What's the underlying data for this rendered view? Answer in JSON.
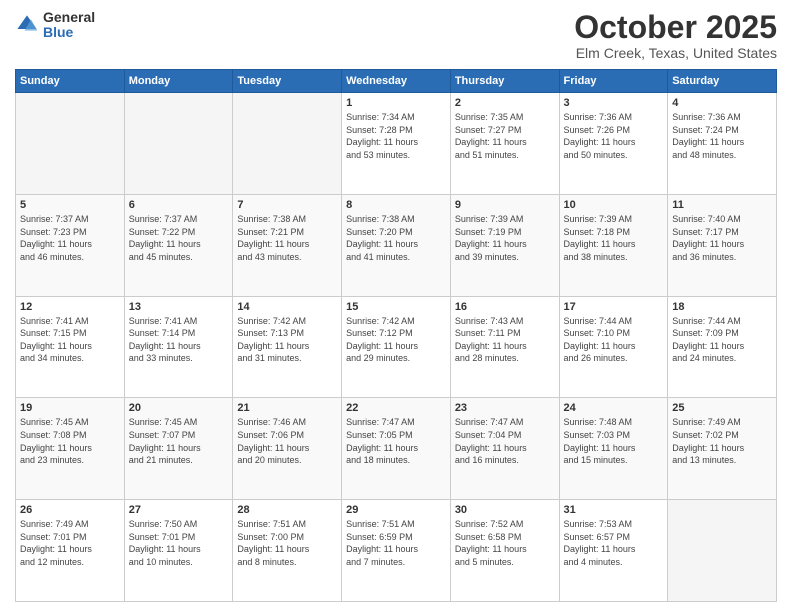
{
  "logo": {
    "general": "General",
    "blue": "Blue"
  },
  "header": {
    "month": "October 2025",
    "location": "Elm Creek, Texas, United States"
  },
  "weekdays": [
    "Sunday",
    "Monday",
    "Tuesday",
    "Wednesday",
    "Thursday",
    "Friday",
    "Saturday"
  ],
  "weeks": [
    [
      {
        "day": "",
        "info": ""
      },
      {
        "day": "",
        "info": ""
      },
      {
        "day": "",
        "info": ""
      },
      {
        "day": "1",
        "info": "Sunrise: 7:34 AM\nSunset: 7:28 PM\nDaylight: 11 hours\nand 53 minutes."
      },
      {
        "day": "2",
        "info": "Sunrise: 7:35 AM\nSunset: 7:27 PM\nDaylight: 11 hours\nand 51 minutes."
      },
      {
        "day": "3",
        "info": "Sunrise: 7:36 AM\nSunset: 7:26 PM\nDaylight: 11 hours\nand 50 minutes."
      },
      {
        "day": "4",
        "info": "Sunrise: 7:36 AM\nSunset: 7:24 PM\nDaylight: 11 hours\nand 48 minutes."
      }
    ],
    [
      {
        "day": "5",
        "info": "Sunrise: 7:37 AM\nSunset: 7:23 PM\nDaylight: 11 hours\nand 46 minutes."
      },
      {
        "day": "6",
        "info": "Sunrise: 7:37 AM\nSunset: 7:22 PM\nDaylight: 11 hours\nand 45 minutes."
      },
      {
        "day": "7",
        "info": "Sunrise: 7:38 AM\nSunset: 7:21 PM\nDaylight: 11 hours\nand 43 minutes."
      },
      {
        "day": "8",
        "info": "Sunrise: 7:38 AM\nSunset: 7:20 PM\nDaylight: 11 hours\nand 41 minutes."
      },
      {
        "day": "9",
        "info": "Sunrise: 7:39 AM\nSunset: 7:19 PM\nDaylight: 11 hours\nand 39 minutes."
      },
      {
        "day": "10",
        "info": "Sunrise: 7:39 AM\nSunset: 7:18 PM\nDaylight: 11 hours\nand 38 minutes."
      },
      {
        "day": "11",
        "info": "Sunrise: 7:40 AM\nSunset: 7:17 PM\nDaylight: 11 hours\nand 36 minutes."
      }
    ],
    [
      {
        "day": "12",
        "info": "Sunrise: 7:41 AM\nSunset: 7:15 PM\nDaylight: 11 hours\nand 34 minutes."
      },
      {
        "day": "13",
        "info": "Sunrise: 7:41 AM\nSunset: 7:14 PM\nDaylight: 11 hours\nand 33 minutes."
      },
      {
        "day": "14",
        "info": "Sunrise: 7:42 AM\nSunset: 7:13 PM\nDaylight: 11 hours\nand 31 minutes."
      },
      {
        "day": "15",
        "info": "Sunrise: 7:42 AM\nSunset: 7:12 PM\nDaylight: 11 hours\nand 29 minutes."
      },
      {
        "day": "16",
        "info": "Sunrise: 7:43 AM\nSunset: 7:11 PM\nDaylight: 11 hours\nand 28 minutes."
      },
      {
        "day": "17",
        "info": "Sunrise: 7:44 AM\nSunset: 7:10 PM\nDaylight: 11 hours\nand 26 minutes."
      },
      {
        "day": "18",
        "info": "Sunrise: 7:44 AM\nSunset: 7:09 PM\nDaylight: 11 hours\nand 24 minutes."
      }
    ],
    [
      {
        "day": "19",
        "info": "Sunrise: 7:45 AM\nSunset: 7:08 PM\nDaylight: 11 hours\nand 23 minutes."
      },
      {
        "day": "20",
        "info": "Sunrise: 7:45 AM\nSunset: 7:07 PM\nDaylight: 11 hours\nand 21 minutes."
      },
      {
        "day": "21",
        "info": "Sunrise: 7:46 AM\nSunset: 7:06 PM\nDaylight: 11 hours\nand 20 minutes."
      },
      {
        "day": "22",
        "info": "Sunrise: 7:47 AM\nSunset: 7:05 PM\nDaylight: 11 hours\nand 18 minutes."
      },
      {
        "day": "23",
        "info": "Sunrise: 7:47 AM\nSunset: 7:04 PM\nDaylight: 11 hours\nand 16 minutes."
      },
      {
        "day": "24",
        "info": "Sunrise: 7:48 AM\nSunset: 7:03 PM\nDaylight: 11 hours\nand 15 minutes."
      },
      {
        "day": "25",
        "info": "Sunrise: 7:49 AM\nSunset: 7:02 PM\nDaylight: 11 hours\nand 13 minutes."
      }
    ],
    [
      {
        "day": "26",
        "info": "Sunrise: 7:49 AM\nSunset: 7:01 PM\nDaylight: 11 hours\nand 12 minutes."
      },
      {
        "day": "27",
        "info": "Sunrise: 7:50 AM\nSunset: 7:01 PM\nDaylight: 11 hours\nand 10 minutes."
      },
      {
        "day": "28",
        "info": "Sunrise: 7:51 AM\nSunset: 7:00 PM\nDaylight: 11 hours\nand 8 minutes."
      },
      {
        "day": "29",
        "info": "Sunrise: 7:51 AM\nSunset: 6:59 PM\nDaylight: 11 hours\nand 7 minutes."
      },
      {
        "day": "30",
        "info": "Sunrise: 7:52 AM\nSunset: 6:58 PM\nDaylight: 11 hours\nand 5 minutes."
      },
      {
        "day": "31",
        "info": "Sunrise: 7:53 AM\nSunset: 6:57 PM\nDaylight: 11 hours\nand 4 minutes."
      },
      {
        "day": "",
        "info": ""
      }
    ]
  ]
}
